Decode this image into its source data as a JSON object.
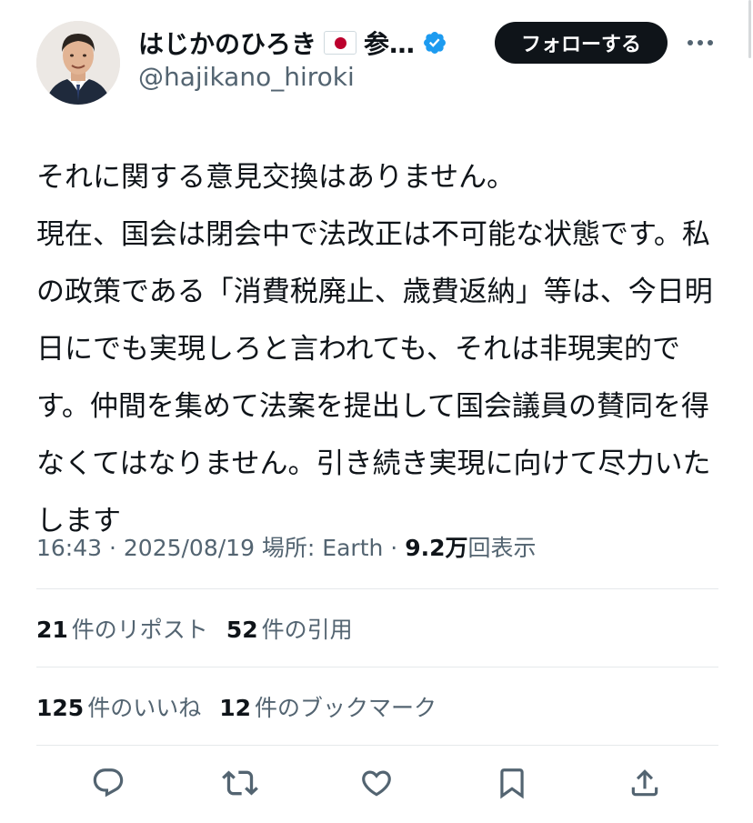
{
  "author": {
    "name": "はじかのひろき",
    "name_rest": "参…",
    "handle": "@hajikano_hiroki",
    "flag_icon": "japan-flag-emoji",
    "verified_icon": "verified-badge-icon",
    "verified_color": "#1d9bf0"
  },
  "follow_button": {
    "label": "フォローする"
  },
  "more_button": {
    "icon": "more-horizontal-icon"
  },
  "tweet": {
    "text": "それに関する意見交換はありません。\n現在、国会は閉会中で法改正は不可能な状態です。私の政策である「消費税廃止、歳費返納」等は、今日明日にでも実現しろと言われても、それは非現実的です。仲間を集めて法案を提出して国会議員の賛同を得なくてはなりません。引き続き実現に向けて尽力いたします"
  },
  "meta": {
    "time": "16:43",
    "sep1": " · ",
    "date": "2025/08/19",
    "location_label": " 場所: Earth",
    "sep2": " · ",
    "views_count": "9.2万",
    "views_label": "回表示"
  },
  "stats_row1": [
    {
      "count": "21",
      "label": "件のリポスト"
    },
    {
      "count": "52",
      "label": "件の引用"
    }
  ],
  "stats_row2": [
    {
      "count": "125",
      "label": "件のいいね"
    },
    {
      "count": "12",
      "label": "件のブックマーク"
    }
  ],
  "actions": [
    {
      "icon": "reply-icon"
    },
    {
      "icon": "repost-icon"
    },
    {
      "icon": "like-icon"
    },
    {
      "icon": "bookmark-icon"
    },
    {
      "icon": "share-icon"
    }
  ],
  "colors": {
    "text": "#0f1419",
    "secondary": "#536471",
    "follow_bg": "#0f1419",
    "divider": "#e6e9eb",
    "flag_red": "#bc002d"
  }
}
